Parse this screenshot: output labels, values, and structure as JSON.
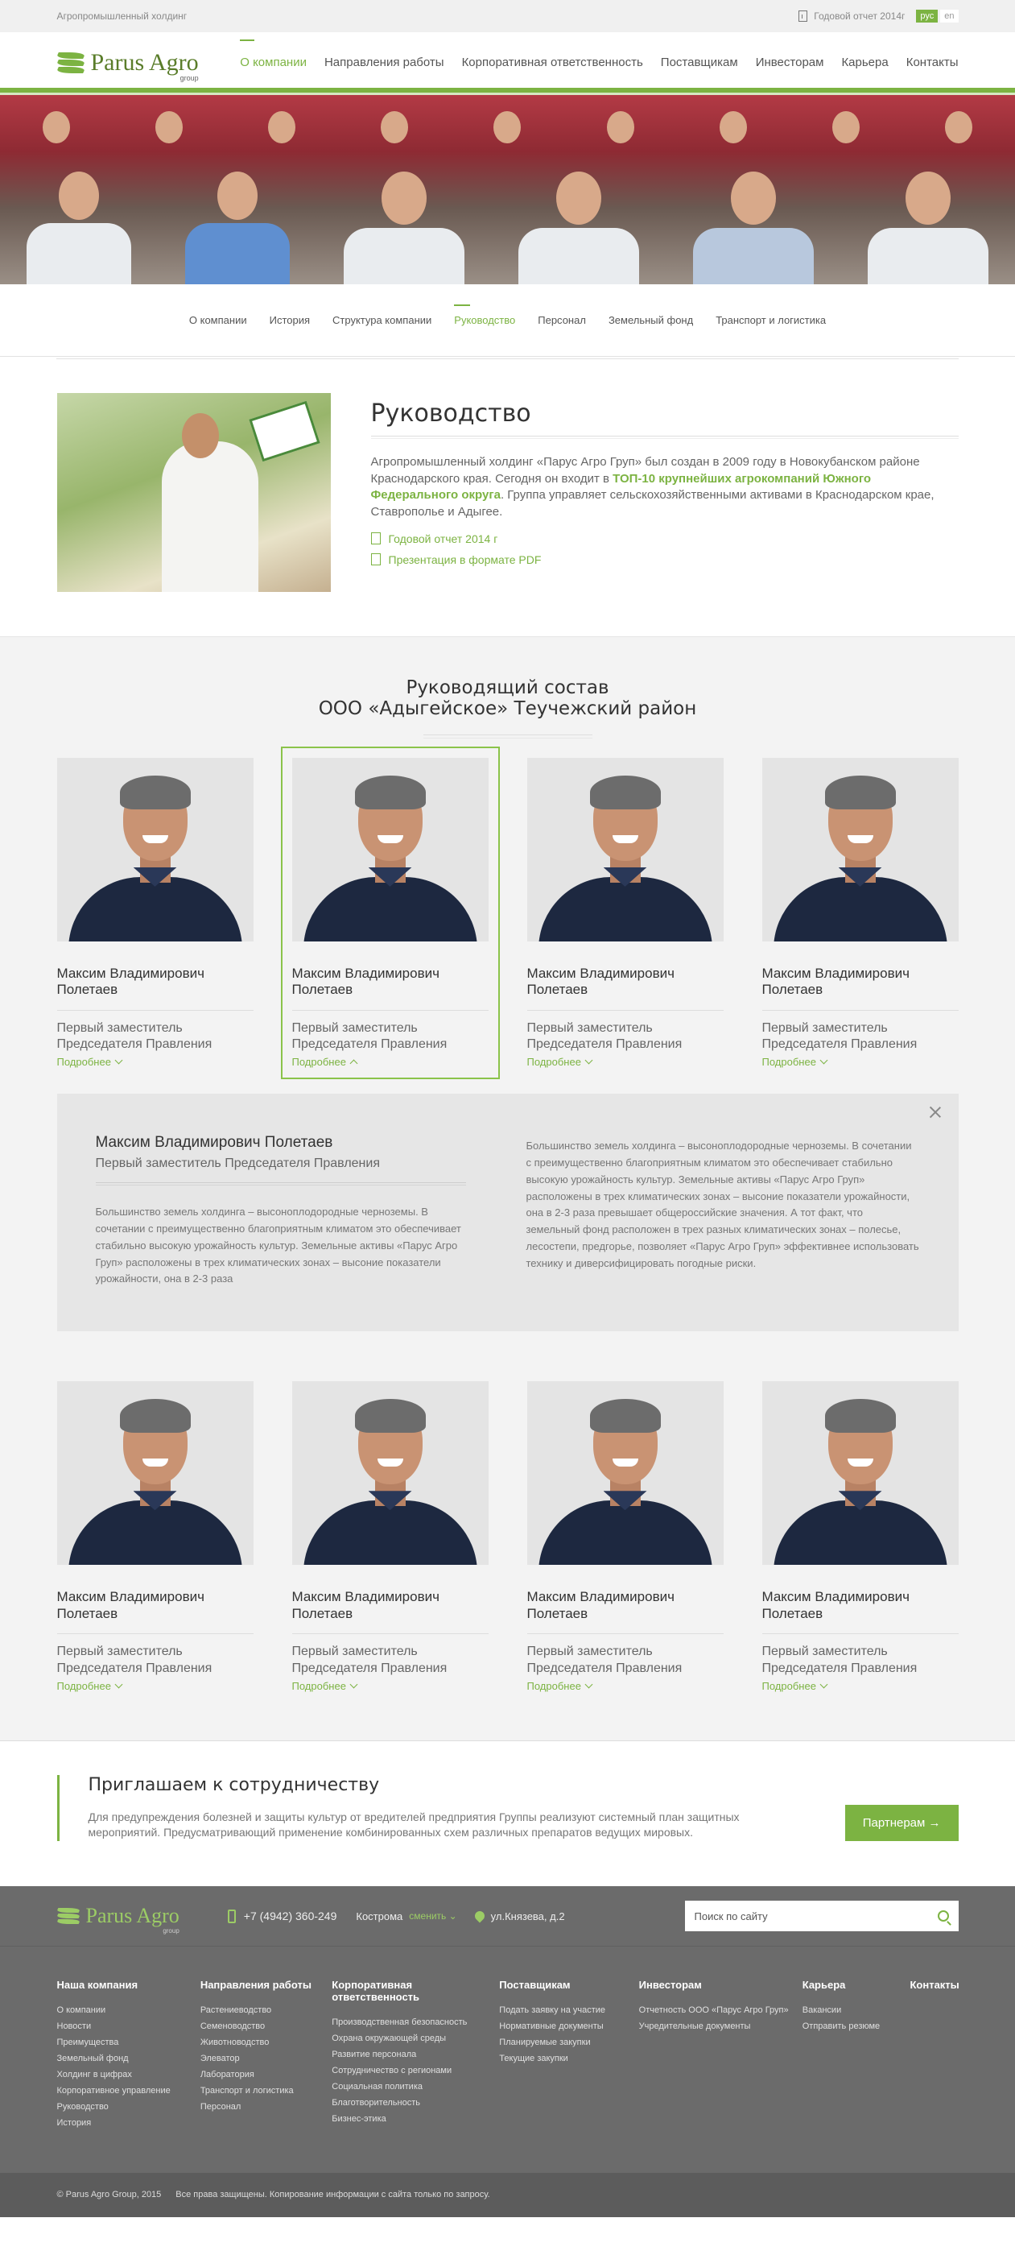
{
  "topbar": {
    "tagline": "Агропромышленный холдинг",
    "report": "Годовой отчет 2014г",
    "langs": [
      "рус",
      "en"
    ]
  },
  "logo": {
    "name": "Parus Agro",
    "sub": "group"
  },
  "nav": [
    "О компании",
    "Направления работы",
    "Корпоративная ответственность",
    "Поставщикам",
    "Инвесторам",
    "Карьера",
    "Контакты"
  ],
  "subnav": [
    "О компании",
    "История",
    "Структура компании",
    "Руководство",
    "Персонал",
    "Земельный фонд",
    "Транспорт и логистика"
  ],
  "intro": {
    "title": "Руководство",
    "text_a": "Агропромышленный холдинг «Парус Агро Груп» был создан в 2009 году в Новокубанском районе Краснодарского края. Сегодня он входит в ",
    "text_bold": "ТОП-10 крупнейших агрокомпаний Южного Федерального округа",
    "text_b": ". Группа управляет сельскохозяйственными активами в Краснодарском крае, Ставрополье и Адыгее.",
    "link1": "Годовой отчет 2014 г",
    "link2": "Презентация в формате PDF"
  },
  "team": {
    "title1": "Руководящий состав",
    "title2": "ООО «Адыгейское» Теучежский район",
    "person": {
      "name": "Максим Владимирович Полетаев",
      "position": "Первый заместитель Председателя Правления",
      "more": "Подробнее"
    },
    "detail": {
      "name": "Максим Владимирович Полетаев",
      "position": "Первый заместитель Председателя Правления",
      "text1": "Большинство земель холдинга – высоноплодородные черноземы. В сочетании с преимущественно благоприятным климатом это обеспечивает стабильно высокую урожайность культур. Земельные активы «Парус Агро Груп» расположены в трех климатических зонах –  высоние показатели урожайности, она в 2-3 раза",
      "text2": "Большинство земель холдинга – высоноплодородные черноземы. В сочетании с преимущественно благоприятным климатом это обеспечивает стабильно высокую урожайность культур. Земельные активы «Парус Агро Груп» расположены в трех климатических зонах –  высоние показатели урожайности, она в 2-3 раза превышает общероссийские значения. А тот факт, что земельный фонд расположен в трех разных климатических зонах – полесье, лесостепи, предгорье, позволяет «Парус Агро Груп» эффективнее использовать технику и диверсифицировать погодные риски."
    }
  },
  "partner": {
    "title": "Приглашаем к сотрудничеству",
    "text": "Для предупреждения болезней и защиты культур от вредителей предприятия Группы реализуют системный план защитных мероприятий. Предусматривающий применение комбинированных схем различных препаратов ведущих мировых.",
    "button": "Партнерам →"
  },
  "footer": {
    "phone": "+7 (4942) 360-249",
    "city": "Кострома",
    "change": "сменить",
    "address": "ул.Князева, д.2",
    "search_placeholder": "Поиск по сайту",
    "cols": [
      {
        "title": "Наша компания",
        "items": [
          "О компании",
          "Новости",
          "Преимущества",
          "Земельный фонд",
          "Холдинг в цифрах",
          "Корпоративное управление",
          "Руководство",
          "История"
        ]
      },
      {
        "title": "Направления работы",
        "items": [
          "Растениеводство",
          "Семеноводство",
          "Животноводство",
          "Элеватор",
          "Лаборатория",
          "Транспорт и логистика",
          "Персонал"
        ]
      },
      {
        "title": "Корпоративная ответственность",
        "items": [
          "Производственная безопасность",
          "Охрана окружающей среды",
          "Развитие персонала",
          "Сотрудничество с регионами",
          "Социальная политика",
          "Благотворительность",
          "Бизнес-этика"
        ]
      },
      {
        "title": "Поставщикам",
        "items": [
          "Подать заявку на участие",
          "Нормативные документы",
          "Планируемые закупки",
          "Текущие закупки"
        ]
      },
      {
        "title": "Инвесторам",
        "items": [
          "Отчетность ООО «Парус Агро Груп»",
          "Учредительные документы"
        ]
      },
      {
        "title": "Карьера",
        "items": [
          "Вакансии",
          "Отправить резюме"
        ]
      },
      {
        "title": "Контакты",
        "items": []
      }
    ],
    "copyright": "© Parus Agro Group, 2015",
    "rights": "Все права защищены. Копирование информации с сайта  только по запросу."
  }
}
